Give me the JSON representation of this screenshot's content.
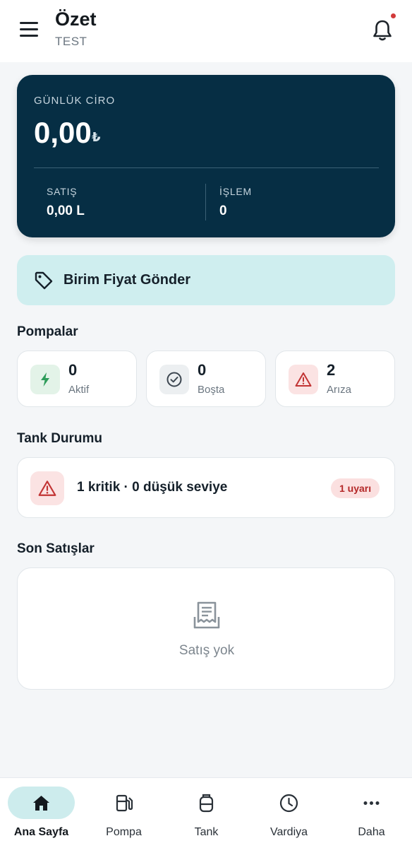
{
  "header": {
    "title": "Özet",
    "subtitle": "TEST"
  },
  "revenue": {
    "label": "GÜNLÜK CİRO",
    "amount": "0,00",
    "currency": "₺",
    "sales_label": "SATIŞ",
    "sales_value": "0,00 L",
    "tx_label": "İŞLEM",
    "tx_value": "0"
  },
  "unit_price_button": {
    "label": "Birim Fiyat Gönder"
  },
  "pumps": {
    "title": "Pompalar",
    "stats": [
      {
        "value": "0",
        "label": "Aktif",
        "icon": "bolt-icon",
        "color": "#2e9c5a"
      },
      {
        "value": "0",
        "label": "Boşta",
        "icon": "check-circle-icon",
        "color": "#3c4650"
      },
      {
        "value": "2",
        "label": "Arıza",
        "icon": "warning-icon",
        "color": "#c23434"
      }
    ]
  },
  "tank_status": {
    "title": "Tank Durumu",
    "summary": "1 kritik · 0 düşük seviye",
    "badge": "1 uyarı"
  },
  "recent_sales": {
    "title": "Son Satışlar",
    "empty_text": "Satış yok"
  },
  "bottom_nav": {
    "items": [
      {
        "label": "Ana Sayfa",
        "icon": "home-icon",
        "active": true
      },
      {
        "label": "Pompa",
        "icon": "fuel-pump-icon",
        "active": false
      },
      {
        "label": "Tank",
        "icon": "tank-icon",
        "active": false
      },
      {
        "label": "Vardiya",
        "icon": "clock-icon",
        "active": false
      },
      {
        "label": "Daha",
        "icon": "more-icon",
        "active": false
      }
    ]
  },
  "colors": {
    "card_dark": "#062e44",
    "accent_light": "#cfeeef",
    "danger": "#c23434",
    "success": "#2e9c5a"
  }
}
